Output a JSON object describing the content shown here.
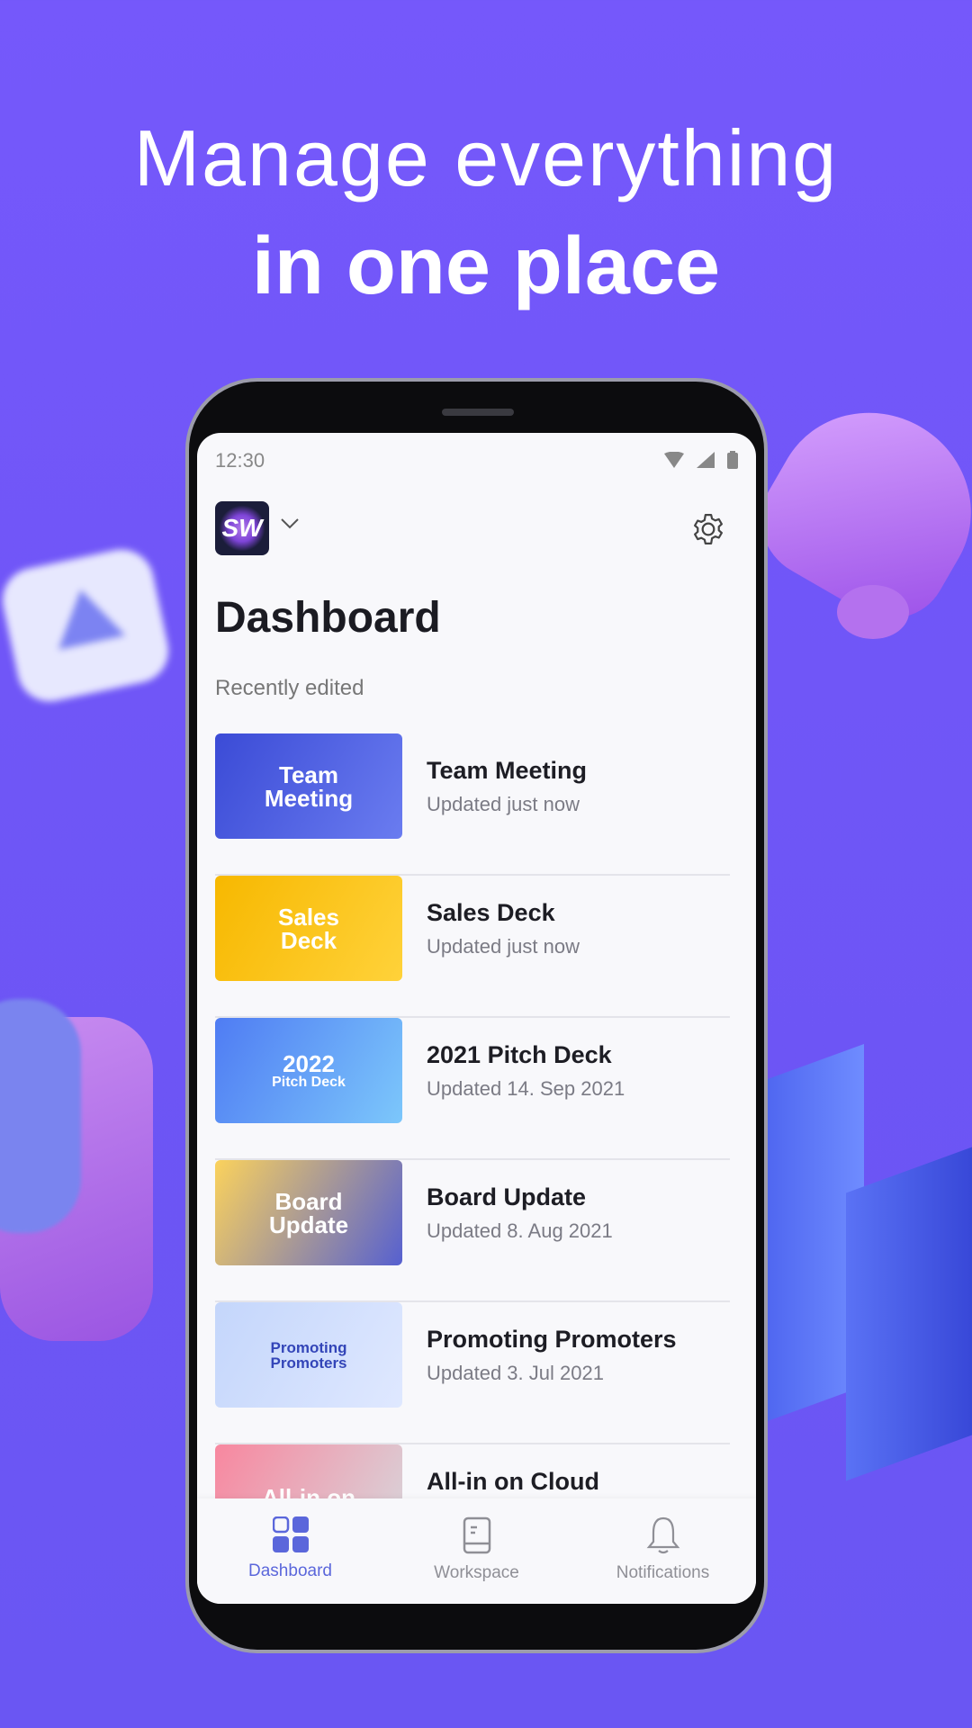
{
  "headline": {
    "line1": "Manage everything",
    "line2": "in one place"
  },
  "status_bar": {
    "time": "12:30"
  },
  "header": {
    "logo_text": "SW",
    "title": "Dashboard",
    "section_label": "Recently edited"
  },
  "items": [
    {
      "title": "Team Meeting",
      "subtitle": "Updated just now",
      "thumb_text": [
        "Team",
        "Meeting"
      ],
      "colors": [
        "#3b4bd6",
        "#6a7cf0"
      ]
    },
    {
      "title": "Sales Deck",
      "subtitle": "Updated just now",
      "thumb_text": [
        "Sales",
        "Deck"
      ],
      "colors": [
        "#f7b800",
        "#ffd23a"
      ]
    },
    {
      "title": "2021 Pitch Deck",
      "subtitle": "Updated 14. Sep 2021",
      "thumb_text": [
        "2022",
        "Pitch Deck"
      ],
      "colors": [
        "#4f7cf3",
        "#7cc7fb"
      ]
    },
    {
      "title": "Board Update",
      "subtitle": "Updated 8. Aug 2021",
      "thumb_text": [
        "Board",
        "Update"
      ],
      "colors": [
        "#fbd25c",
        "#5660d0"
      ]
    },
    {
      "title": "Promoting Promoters",
      "subtitle": "Updated 3. Jul 2021",
      "thumb_text": [
        "Promoting",
        "Promoters"
      ],
      "colors": [
        "#c4d6fb",
        "#dfe8ff"
      ]
    },
    {
      "title": "All-in on Cloud",
      "subtitle": "",
      "thumb_text": [
        "All-in on",
        ""
      ],
      "colors": [
        "#f8879f",
        "#d7d7dc"
      ]
    }
  ],
  "nav": [
    {
      "label": "Dashboard",
      "icon": "grid-icon",
      "active": true
    },
    {
      "label": "Workspace",
      "icon": "book-icon"
    },
    {
      "label": "Notifications",
      "icon": "bell-icon"
    }
  ],
  "colors": {
    "accent": "#5b67db",
    "background": "#7558fb"
  }
}
